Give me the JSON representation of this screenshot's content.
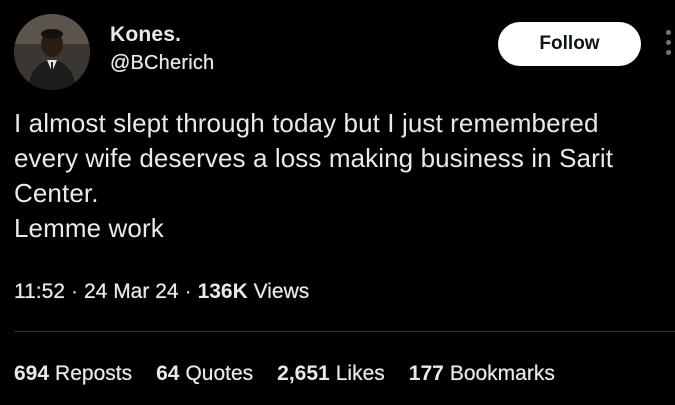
{
  "author": {
    "display_name": "Kones.",
    "handle": "@BCherich",
    "avatar_icon": "profile-photo"
  },
  "follow_label": "Follow",
  "tweet": {
    "lines": [
      "I almost slept through today but I just remembered",
      "every wife deserves a loss making business in Sarit",
      "Center.",
      "Lemme work"
    ]
  },
  "meta": {
    "time": "11:52",
    "date": "24 Mar 24",
    "views_count": "136K",
    "views_label": "Views"
  },
  "stats": [
    {
      "count": "694",
      "label": "Reposts"
    },
    {
      "count": "64",
      "label": "Quotes"
    },
    {
      "count": "2,651",
      "label": "Likes"
    },
    {
      "count": "177",
      "label": "Bookmarks"
    }
  ],
  "colors": {
    "background": "#000000",
    "text": "#e7e9ea",
    "button_bg": "#ffffff",
    "button_text": "#0f1419",
    "divider": "#2f3336"
  }
}
